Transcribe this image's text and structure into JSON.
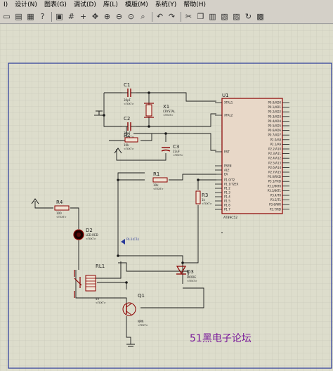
{
  "menu": {
    "items": [
      "I)",
      "设计(N)",
      "图表(G)",
      "调试(D)",
      "库(L)",
      "模版(M)",
      "系统(Y)",
      "帮助(H)"
    ]
  },
  "toolbar": {
    "icons": [
      "new-sheet-icon",
      "open-icon",
      "print-icon",
      "help-icon",
      "sep",
      "component-mode-icon",
      "grid-icon",
      "origin-icon",
      "pan-icon",
      "zoom-in-icon",
      "zoom-out-icon",
      "zoom-all-icon",
      "zoom-area-icon",
      "sep",
      "undo-icon",
      "redo-icon",
      "sep",
      "cut-icon",
      "copy-icon",
      "paste-icon",
      "block-copy-icon",
      "block-move-icon",
      "block-rotate-icon",
      "block-delete-icon"
    ]
  },
  "schematic": {
    "u1": {
      "ref": "U1",
      "part": "AT89C52",
      "left_pins": [
        "XTAL1",
        "XTAL2",
        "RST",
        "PSEN",
        "ALE",
        "EA"
      ],
      "left_lower_pins": [
        "P1.0/T2",
        "P1.1/T2EX",
        "P1.2",
        "P1.3",
        "P1.4",
        "P1.5",
        "P1.6",
        "P1.7"
      ],
      "right_pins": [
        "P0.0/AD0",
        "P0.1/AD1",
        "P0.2/AD2",
        "P0.3/AD3",
        "P0.4/AD4",
        "P0.5/AD5",
        "P0.6/AD6",
        "P0.7/AD7",
        "P2.0/A8",
        "P2.1/A9",
        "P2.2/A10",
        "P2.3/A11",
        "P2.4/A12",
        "P2.5/A13",
        "P2.6/A14",
        "P2.7/A15",
        "P3.0/RXD",
        "P3.1/TXD",
        "P3.2/INT0",
        "P3.3/INT1",
        "P3.4/T0",
        "P3.5/T1",
        "P3.6/WR",
        "P3.7/RD"
      ]
    },
    "c1": {
      "ref": "C1",
      "value": "30pF",
      "text": "<TEXT>"
    },
    "c2": {
      "ref": "C2",
      "value": "30pF",
      "text": "<TEXT>"
    },
    "c3": {
      "ref": "C3",
      "value": "22uF",
      "text": "<TEXT>"
    },
    "x1": {
      "ref": "X1",
      "value": "CRYSTAL",
      "text": "<TEXT>"
    },
    "r1": {
      "ref": "R1",
      "value": "10k",
      "text": "<TEXT>"
    },
    "r2": {
      "ref": "R2",
      "value": "10k",
      "text": "<TEXT>"
    },
    "r3": {
      "ref": "R3",
      "value": "1k",
      "text": "<TEXT>"
    },
    "r4": {
      "ref": "R4",
      "value": "100",
      "text": "<TEXT>"
    },
    "d2": {
      "ref": "D2",
      "value": "LED-RED",
      "text": "<TEXT>"
    },
    "d3": {
      "ref": "D3",
      "value": "DIODE",
      "text": "<TEXT>"
    },
    "rl1": {
      "ref": "RL1",
      "value": "5V",
      "text": "<TEXT>"
    },
    "q1": {
      "ref": "Q1",
      "value": "NPN",
      "text": "<TEXT>"
    },
    "probe": {
      "label": "RL1(C1)"
    }
  },
  "watermark": "51黑电子论坛",
  "colors": {
    "sheet_bg": "#ddddcc",
    "grid": "#c4c4b4",
    "border": "#2a3a9a",
    "component": "#8b0000",
    "wire": "#1a1a1a",
    "watermark": "#7a1a9a",
    "led": "#1a0000"
  }
}
